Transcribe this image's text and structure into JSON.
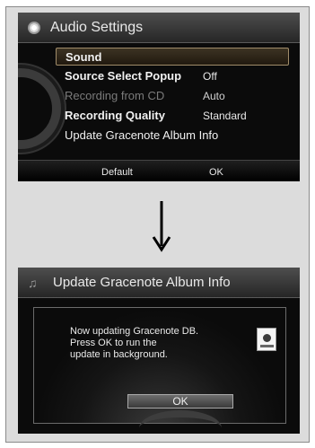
{
  "screen1": {
    "title": "Audio Settings",
    "menu": [
      {
        "label": "Sound",
        "value": ""
      },
      {
        "label": "Source Select Popup",
        "value": "Off"
      },
      {
        "label": "Recording from CD",
        "value": "Auto"
      },
      {
        "label": "Recording Quality",
        "value": "Standard"
      },
      {
        "label": "Update Gracenote Album Info",
        "value": ""
      }
    ],
    "footer": {
      "left": "Default",
      "right": "OK"
    }
  },
  "screen2": {
    "title": "Update Gracenote Album Info",
    "message": [
      "Now updating Gracenote DB.",
      "Press OK to run the",
      "update in background."
    ],
    "ok_label": "OK"
  },
  "colors": {
    "highlight_border": "#a08c6a",
    "screen_bg": "#0b0b0b",
    "frame_bg": "#dcdcdc"
  }
}
